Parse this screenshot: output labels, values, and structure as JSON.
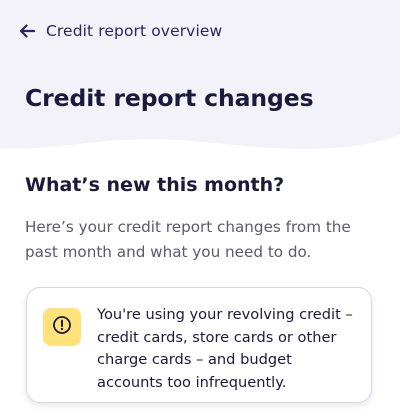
{
  "header": {
    "back_label": "Credit report overview",
    "back_icon": "arrow-left-icon",
    "title": "Credit report changes",
    "background_color": "#f3f2f8"
  },
  "section": {
    "title": "What’s new this month?",
    "description": "Here’s your credit report changes from the past month and what you need to do."
  },
  "notice": {
    "icon": "exclamation-circle-icon",
    "icon_background": "#ffe27a",
    "text": "You're using your revolving credit – credit cards, store cards or other charge cards – and budget accounts too infrequently."
  },
  "colors": {
    "text_primary": "#1c1a3a",
    "text_secondary": "#5b5a6a",
    "accent": "#2b2462"
  }
}
